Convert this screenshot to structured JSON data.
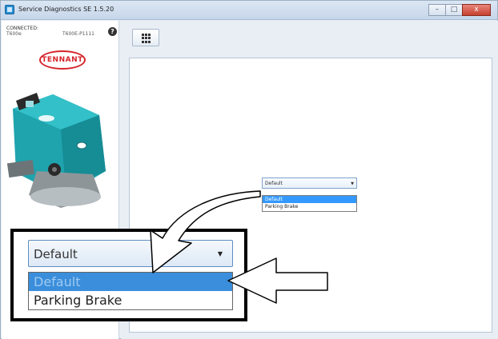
{
  "window": {
    "title": "Service Diagnostics SE 1.5.20",
    "controls": {
      "minimize": "–",
      "maximize": "□",
      "close": "x"
    }
  },
  "sidebar": {
    "status": "CONNECTED:",
    "model": "T600e",
    "serial": "T600E-P1111",
    "help_icon": "?",
    "brand": "TENNANT"
  },
  "toolbar": {
    "grid_icon": "grid-menu-icon"
  },
  "small_dropdown": {
    "selected": "Default",
    "options": [
      "Default",
      "Parking Brake"
    ],
    "highlighted_index": 0
  },
  "zoom_callout": {
    "selected": "Default",
    "options": [
      "Default",
      "Parking Brake"
    ],
    "highlighted_index": 0
  },
  "colors": {
    "highlight": "#3399ff",
    "brand_red": "#d5252b",
    "callout_border": "#000000"
  }
}
